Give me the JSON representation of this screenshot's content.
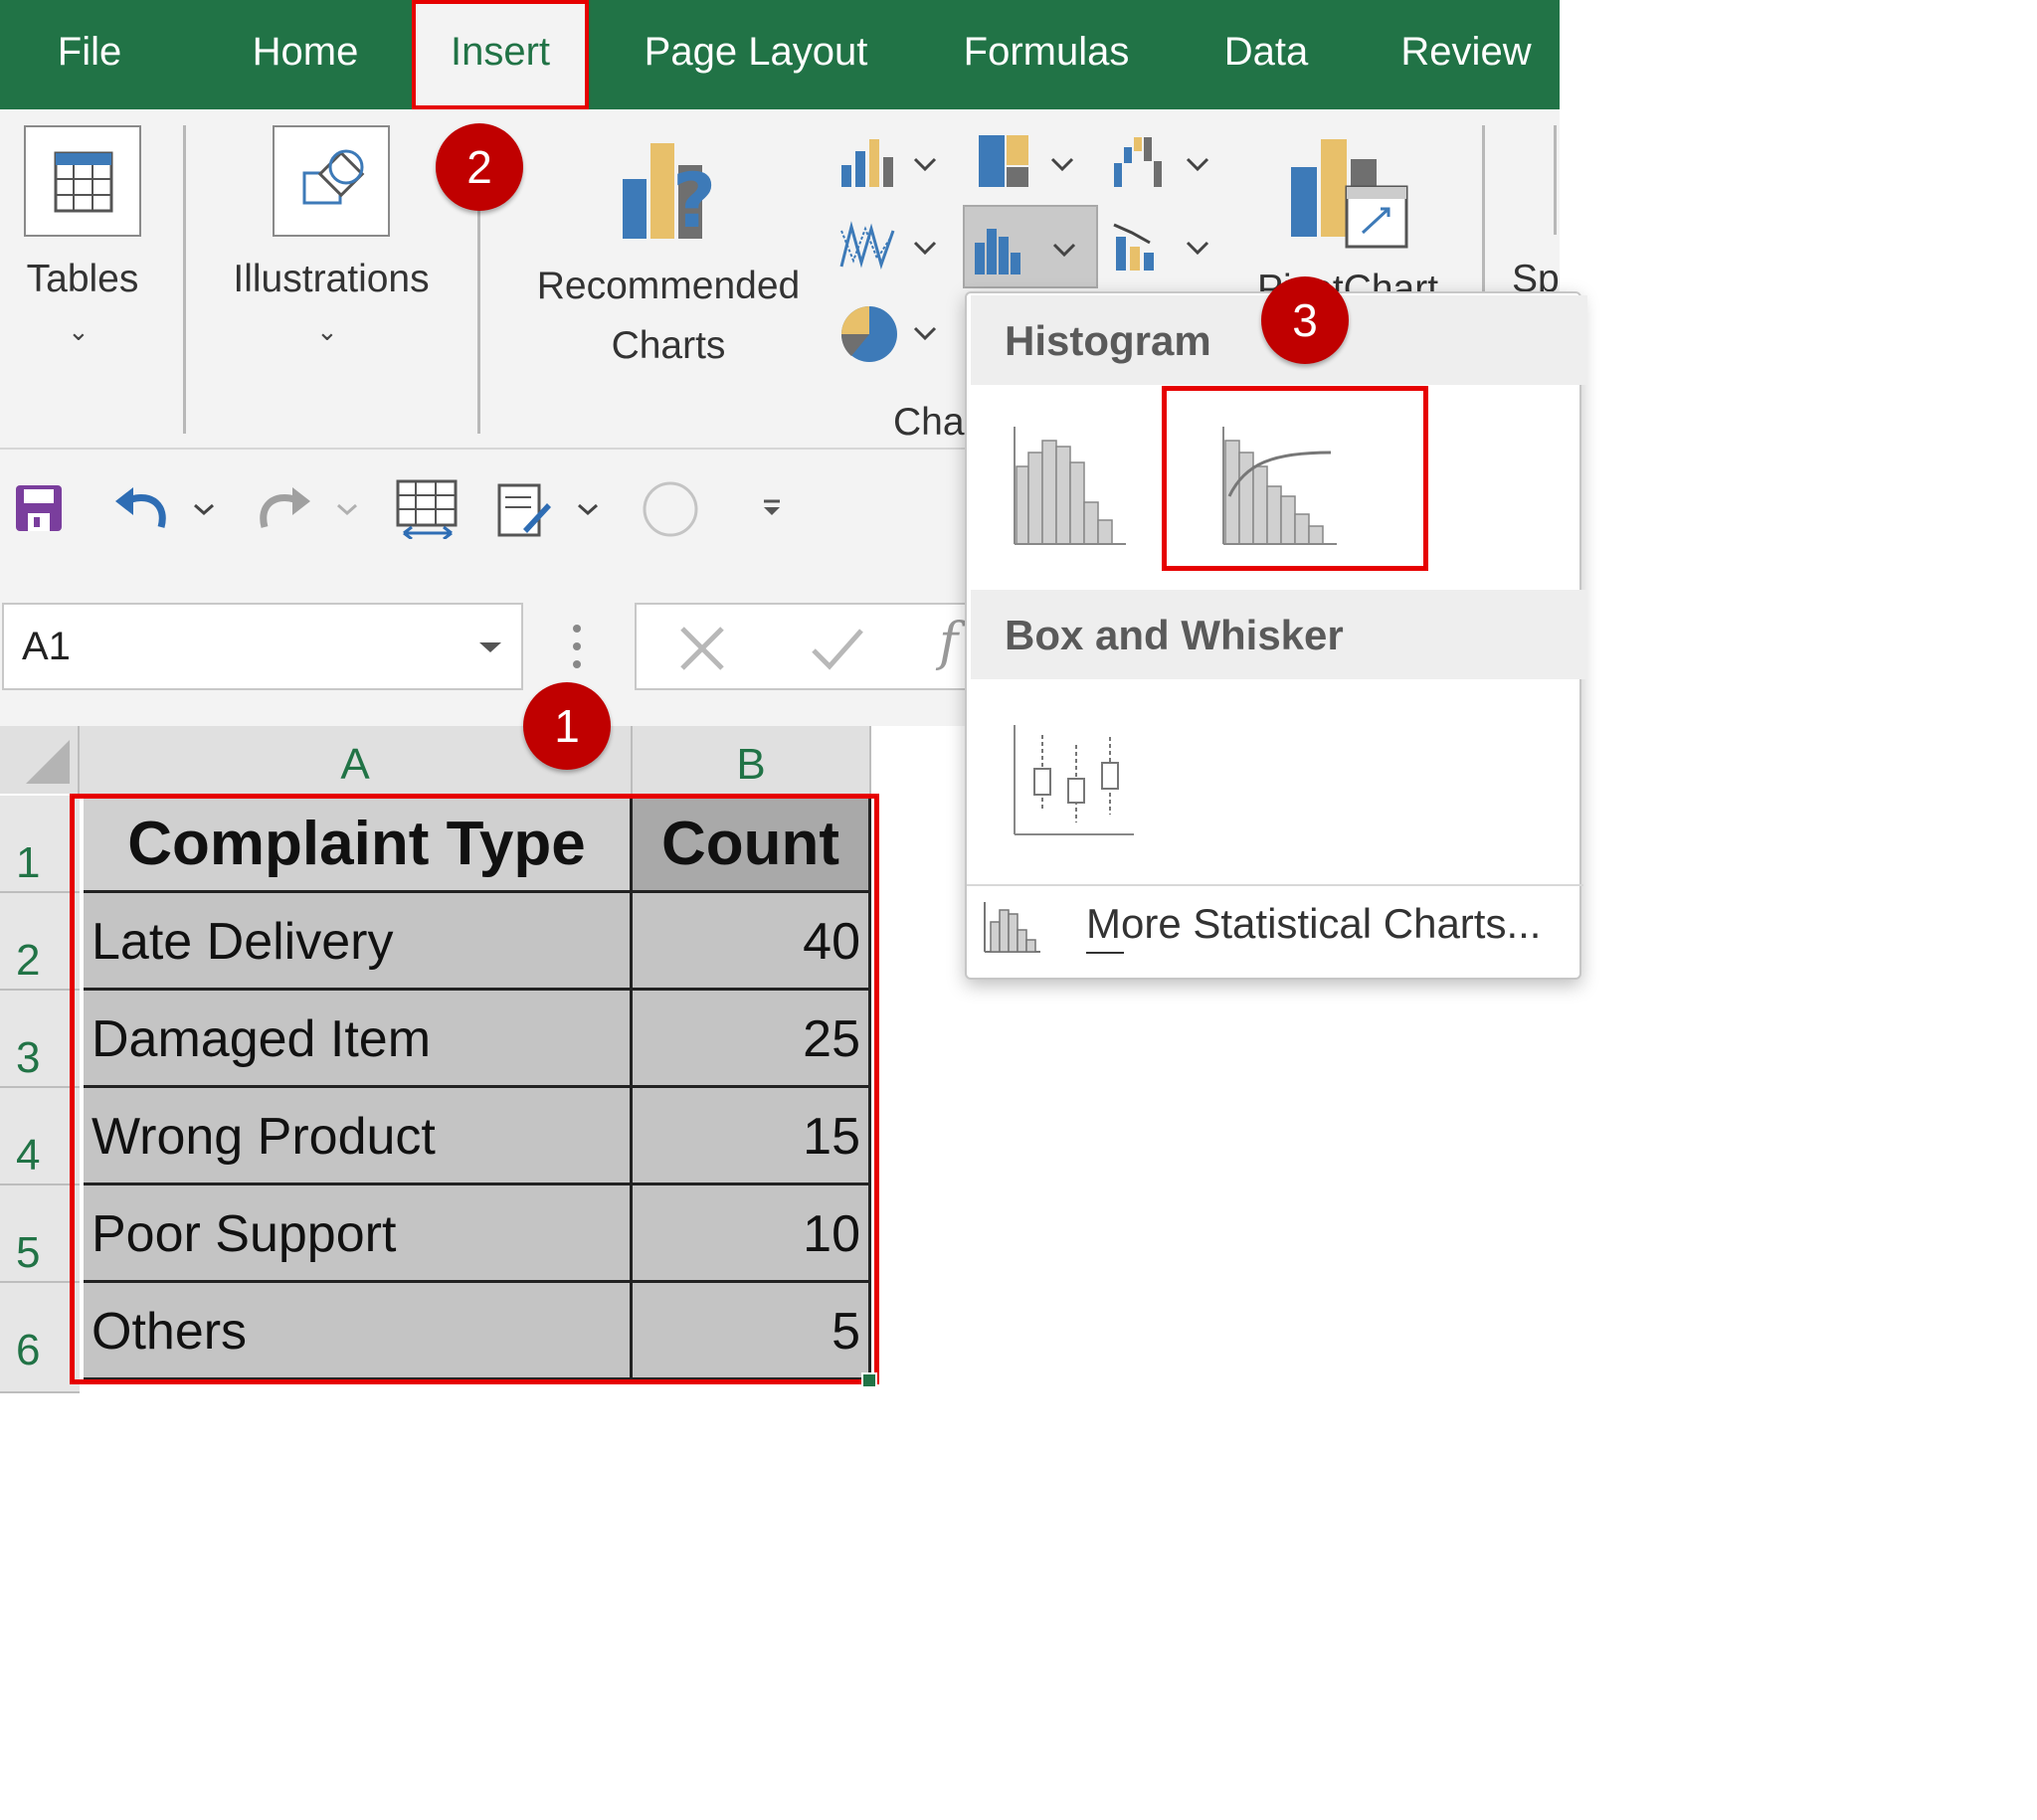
{
  "menu": {
    "tabs": [
      {
        "label": "File"
      },
      {
        "label": "Home"
      },
      {
        "label": "Insert"
      },
      {
        "label": "Page Layout"
      },
      {
        "label": "Formulas"
      },
      {
        "label": "Data"
      },
      {
        "label": "Review"
      }
    ],
    "active_tab": "Insert"
  },
  "ribbon": {
    "tables_label": "Tables",
    "illustrations_label": "Illustrations",
    "recommended_line1": "Recommended",
    "recommended_line2": "Charts",
    "charts_group_label": "Char",
    "pivotchart_label": "PivotChart",
    "sparklines_label": "Sp"
  },
  "formula_bar": {
    "name_box_value": "A1",
    "fx_label": "f"
  },
  "sheet": {
    "columns": [
      "A",
      "B"
    ],
    "rows": [
      "1",
      "2",
      "3",
      "4",
      "5",
      "6"
    ],
    "header": {
      "col_a": "Complaint Type",
      "col_b": "Count"
    },
    "data": [
      {
        "type": "Late Delivery",
        "count": "40"
      },
      {
        "type": "Damaged Item",
        "count": "25"
      },
      {
        "type": "Wrong Product",
        "count": "15"
      },
      {
        "type": "Poor Support",
        "count": "10"
      },
      {
        "type": "Others",
        "count": "5"
      }
    ]
  },
  "dropdown": {
    "histogram_title": "Histogram",
    "box_whisker_title": "Box and Whisker",
    "more_link": "More Statistical Charts..."
  },
  "callouts": {
    "step1": "1",
    "step2": "2",
    "step3": "3"
  },
  "colors": {
    "excel_green": "#217346",
    "highlight_red": "#e60000",
    "badge_red": "#c00000",
    "chart_blue": "#3d7ab8",
    "chart_gold": "#e8c06a"
  }
}
